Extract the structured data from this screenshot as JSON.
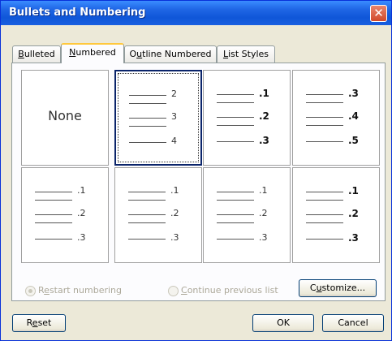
{
  "window": {
    "title": "Bullets and Numbering",
    "close_glyph": "✕"
  },
  "tabs": [
    {
      "pre": "",
      "key": "B",
      "post": "ulleted"
    },
    {
      "pre": "",
      "key": "N",
      "post": "umbered"
    },
    {
      "pre": "O",
      "key": "u",
      "post": "tline Numbered"
    },
    {
      "pre": "",
      "key": "L",
      "post": "ist Styles"
    }
  ],
  "active_tab": "Numbered",
  "gallery": {
    "none_label": "None",
    "cells": [
      {
        "nums": [
          "2",
          "3",
          "4"
        ],
        "bold": false,
        "selected": true
      },
      {
        "nums": [
          ".1",
          ".2",
          ".3"
        ],
        "bold": true,
        "selected": false
      },
      {
        "nums": [
          ".3",
          ".4",
          ".5"
        ],
        "bold": true,
        "selected": false
      },
      {
        "nums": [
          ".1",
          ".2",
          ".3"
        ],
        "bold": false,
        "selected": false
      },
      {
        "nums": [
          ".1",
          ".2",
          ".3"
        ],
        "bold": false,
        "selected": false
      },
      {
        "nums": [
          ".1",
          ".2",
          ".3"
        ],
        "bold": false,
        "selected": false
      },
      {
        "nums": [
          ".1",
          ".2",
          ".3"
        ],
        "bold": true,
        "selected": false
      }
    ]
  },
  "options": {
    "restart": {
      "pre": "R",
      "key": "e",
      "post": "start numbering",
      "checked": true
    },
    "continue": {
      "pre": "",
      "key": "C",
      "post": "ontinue previous list",
      "checked": false
    }
  },
  "buttons": {
    "customize": {
      "pre": "C",
      "key": "u",
      "post": "stomize..."
    },
    "reset": {
      "pre": "R",
      "key": "e",
      "post": "set"
    },
    "ok": "OK",
    "cancel": "Cancel"
  }
}
